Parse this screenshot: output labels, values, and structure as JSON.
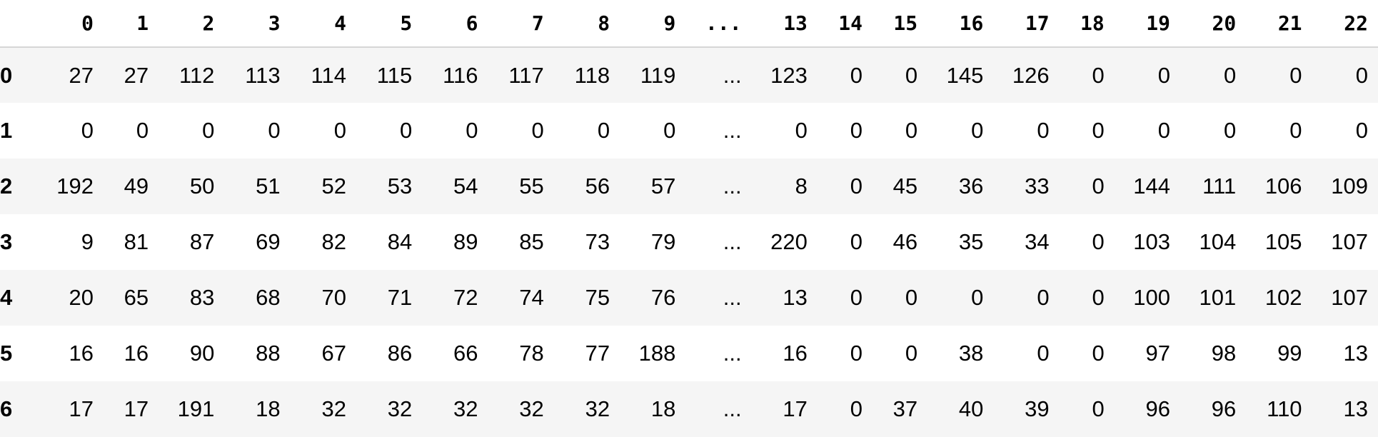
{
  "table": {
    "columns": [
      "",
      "0",
      "1",
      "2",
      "3",
      "4",
      "5",
      "6",
      "7",
      "8",
      "9",
      "...",
      "13",
      "14",
      "15",
      "16",
      "17",
      "18",
      "19",
      "20",
      "21",
      "22"
    ],
    "rows": [
      {
        "index": "0",
        "cells": [
          "27",
          "27",
          "112",
          "113",
          "114",
          "115",
          "116",
          "117",
          "118",
          "119",
          "...",
          "123",
          "0",
          "0",
          "145",
          "126",
          "0",
          "0",
          "0",
          "0",
          "0"
        ]
      },
      {
        "index": "1",
        "cells": [
          "0",
          "0",
          "0",
          "0",
          "0",
          "0",
          "0",
          "0",
          "0",
          "0",
          "...",
          "0",
          "0",
          "0",
          "0",
          "0",
          "0",
          "0",
          "0",
          "0",
          "0"
        ]
      },
      {
        "index": "2",
        "cells": [
          "192",
          "49",
          "50",
          "51",
          "52",
          "53",
          "54",
          "55",
          "56",
          "57",
          "...",
          "8",
          "0",
          "45",
          "36",
          "33",
          "0",
          "144",
          "111",
          "106",
          "109"
        ]
      },
      {
        "index": "3",
        "cells": [
          "9",
          "81",
          "87",
          "69",
          "82",
          "84",
          "89",
          "85",
          "73",
          "79",
          "...",
          "220",
          "0",
          "46",
          "35",
          "34",
          "0",
          "103",
          "104",
          "105",
          "107"
        ]
      },
      {
        "index": "4",
        "cells": [
          "20",
          "65",
          "83",
          "68",
          "70",
          "71",
          "72",
          "74",
          "75",
          "76",
          "...",
          "13",
          "0",
          "0",
          "0",
          "0",
          "0",
          "100",
          "101",
          "102",
          "107"
        ]
      },
      {
        "index": "5",
        "cells": [
          "16",
          "16",
          "90",
          "88",
          "67",
          "86",
          "66",
          "78",
          "77",
          "188",
          "...",
          "16",
          "0",
          "0",
          "38",
          "0",
          "0",
          "97",
          "98",
          "99",
          "13"
        ]
      },
      {
        "index": "6",
        "cells": [
          "17",
          "17",
          "191",
          "18",
          "32",
          "32",
          "32",
          "32",
          "32",
          "18",
          "...",
          "17",
          "0",
          "37",
          "40",
          "39",
          "0",
          "96",
          "96",
          "110",
          "13"
        ]
      }
    ]
  }
}
